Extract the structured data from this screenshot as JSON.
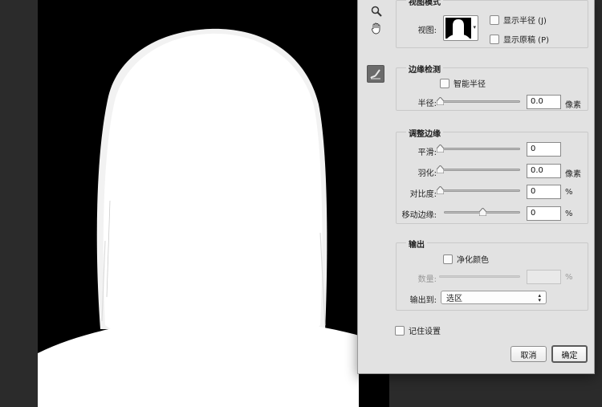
{
  "view_mode": {
    "title": "视图模式",
    "view_label": "视图:",
    "show_radius": "显示半径 (J)",
    "show_original": "显示原稿 (P)"
  },
  "edge_detection": {
    "title": "边缘检测",
    "smart_radius": "智能半径",
    "radius_label": "半径:",
    "radius_value": "0.0",
    "radius_unit": "像素",
    "radius_level": 0
  },
  "adjust_edge": {
    "title": "调整边缘",
    "smooth_label": "平滑:",
    "smooth_value": "0",
    "smooth_level": 0,
    "feather_label": "羽化:",
    "feather_value": "0.0",
    "feather_unit": "像素",
    "feather_level": 0,
    "contrast_label": "对比度:",
    "contrast_value": "0",
    "contrast_unit": "%",
    "contrast_level": 0,
    "shift_label": "移动边缘:",
    "shift_value": "0",
    "shift_unit": "%",
    "shift_level": 0.5
  },
  "output": {
    "title": "输出",
    "decontaminate": "净化颜色",
    "amount_label": "数量:",
    "amount_unit": "%",
    "output_to_label": "输出到:",
    "output_to_value": "选区"
  },
  "remember_settings": "记住设置",
  "buttons": {
    "cancel": "取消",
    "ok": "确定"
  },
  "colors": {
    "dialog_bg": "#e2e2e2",
    "mask_white": "#ffffff",
    "mask_black": "#000000",
    "workspace": "#2b2b2b"
  }
}
